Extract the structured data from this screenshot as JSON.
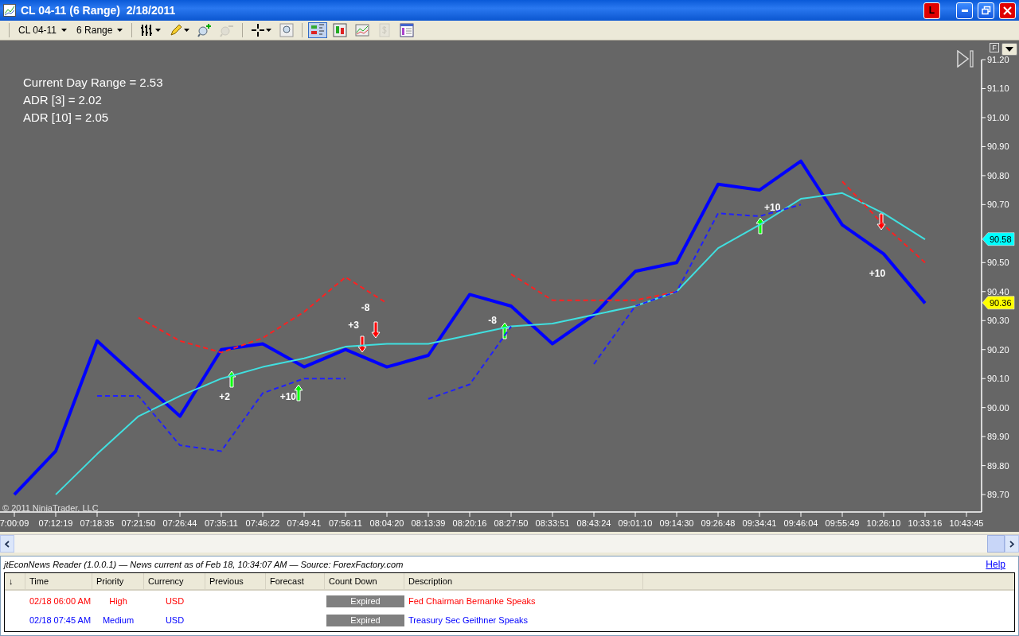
{
  "window": {
    "title": "CL 04-11 (6 Range)  2/18/2011",
    "badge": "L"
  },
  "toolbar": {
    "instrument": "CL 04-11",
    "period": "6 Range",
    "tools": [
      {
        "kind": "bar-style",
        "disabled": false,
        "selected": false
      },
      {
        "kind": "pencil",
        "disabled": false,
        "selected": false
      },
      {
        "kind": "zoom-in",
        "disabled": false,
        "selected": false
      },
      {
        "kind": "zoom-out",
        "disabled": true,
        "selected": false
      },
      {
        "kind": "crosshair",
        "disabled": false,
        "selected": false
      },
      {
        "kind": "zoom-box",
        "disabled": false,
        "selected": false
      },
      {
        "kind": "panels",
        "disabled": false,
        "selected": true
      },
      {
        "kind": "candles",
        "disabled": false,
        "selected": false
      },
      {
        "kind": "indicator",
        "disabled": false,
        "selected": false
      },
      {
        "kind": "dollar",
        "disabled": true,
        "selected": false
      },
      {
        "kind": "properties",
        "disabled": false,
        "selected": false
      }
    ]
  },
  "chart": {
    "stats": [
      "Current Day Range = 2.53",
      "ADR [3] = 2.02",
      "ADR [10] = 2.05"
    ],
    "f_button": "F",
    "copyright": "© 2011 NinjaTrader, LLC",
    "price_flags": [
      {
        "text": "90.58",
        "color": "#00ffff"
      },
      {
        "text": "90.36",
        "color": "#ffff00"
      }
    ],
    "trades": [
      {
        "text": "+2",
        "kind": "up"
      },
      {
        "text": "+10",
        "kind": "up"
      },
      {
        "text": "+3",
        "kind": "down"
      },
      {
        "kind": "down"
      },
      {
        "text": "-8",
        "kind": "label"
      },
      {
        "text": "-8",
        "kind": "up"
      },
      {
        "text": "+10",
        "kind": "up"
      },
      {
        "text": "+10",
        "kind": "down"
      }
    ],
    "chart_data": {
      "type": "line",
      "categories": [
        "7:00:09",
        "07:12:19",
        "07:18:35",
        "07:21:50",
        "07:26:44",
        "07:35:11",
        "07:46:22",
        "07:49:41",
        "07:56:11",
        "08:04:20",
        "08:13:39",
        "08:20:16",
        "08:27:50",
        "08:33:51",
        "08:43:24",
        "09:01:10",
        "09:14:30",
        "09:26:48",
        "09:34:41",
        "09:46:04",
        "09:55:49",
        "10:26:10",
        "10:33:16",
        "10:43:45"
      ],
      "series": [
        {
          "color": "#0000ff",
          "line_style": "solid",
          "values": [
            89.7,
            89.85,
            90.23,
            90.1,
            89.97,
            90.2,
            90.22,
            90.14,
            90.2,
            90.14,
            90.18,
            90.39,
            90.35,
            90.22,
            90.32,
            90.47,
            90.5,
            90.77,
            90.75,
            90.85,
            90.63,
            90.53,
            90.36,
            null
          ]
        },
        {
          "color": "#40e0e0",
          "line_style": "solid",
          "values": [
            null,
            89.7,
            89.84,
            89.97,
            90.04,
            90.1,
            90.14,
            90.17,
            90.21,
            90.22,
            90.22,
            90.25,
            90.28,
            90.29,
            90.32,
            90.35,
            90.4,
            90.55,
            90.63,
            90.72,
            90.74,
            90.67,
            90.58,
            null
          ]
        },
        {
          "color": "#ff2020",
          "line_style": "dashed",
          "values": [
            null,
            null,
            null,
            90.31,
            90.23,
            90.19,
            90.24,
            90.33,
            90.45,
            90.36,
            null,
            null,
            90.46,
            90.37,
            90.37,
            90.37,
            90.4,
            null,
            null,
            null,
            90.78,
            90.63,
            90.5,
            null
          ]
        },
        {
          "color": "#2020ff",
          "line_style": "dashed",
          "values": [
            null,
            null,
            90.04,
            90.04,
            89.87,
            89.85,
            90.05,
            90.1,
            90.1,
            null,
            90.03,
            90.08,
            90.28,
            null,
            90.15,
            90.35,
            90.4,
            90.67,
            90.66,
            90.7,
            null,
            null,
            null,
            null
          ]
        }
      ],
      "ylim": [
        89.64,
        91.2
      ],
      "yticks": [
        {
          "value": 89.7,
          "label": "89.70"
        },
        {
          "value": 89.8,
          "label": "89.80"
        },
        {
          "value": 89.9,
          "label": "89.90"
        },
        {
          "value": 90.0,
          "label": "90.00"
        },
        {
          "value": 90.1,
          "label": "90.10"
        },
        {
          "value": 90.2,
          "label": "90.20"
        },
        {
          "value": 90.3,
          "label": "90.30"
        },
        {
          "value": 90.4,
          "label": "90.40"
        },
        {
          "value": 90.5,
          "label": "90.50"
        },
        {
          "value": 90.7,
          "label": "90.70"
        },
        {
          "value": 90.8,
          "label": "90.80"
        },
        {
          "value": 90.9,
          "label": "90.90"
        },
        {
          "value": 91.0,
          "label": "91.00"
        },
        {
          "value": 91.1,
          "label": "91.10"
        },
        {
          "value": 91.2,
          "label": "91.20"
        }
      ]
    }
  },
  "news": {
    "header": "jtEconNews Reader (1.0.0.1) — News current as of Feb 18, 10:34:07 AM — Source: ForexFactory.com",
    "help": "Help",
    "columns": [
      "↓",
      "Time",
      "Priority",
      "Currency",
      "Previous",
      "Forecast",
      "Count Down",
      "Description"
    ],
    "rows": [
      {
        "time": "02/18 06:00 AM",
        "priority": "High",
        "currency": "USD",
        "countdown": "Expired",
        "description": "Fed Chairman Bernanke Speaks",
        "color": "#ff0000"
      },
      {
        "time": "02/18 07:45 AM",
        "priority": "Medium",
        "currency": "USD",
        "countdown": "Expired",
        "description": "Treasury Sec Geithner Speaks",
        "color": "#0000ff"
      }
    ]
  }
}
